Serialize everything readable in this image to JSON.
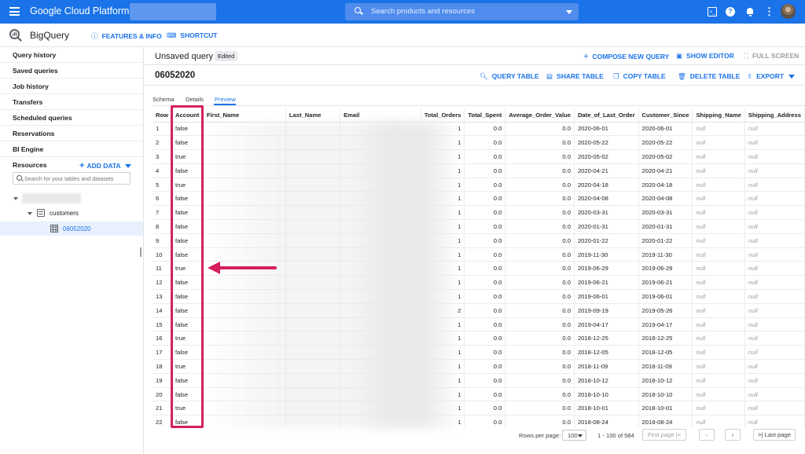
{
  "topbar": {
    "brand": "Google Cloud Platform",
    "search_placeholder": "Search products and resources"
  },
  "subheader": {
    "product": "BigQuery",
    "features_label": "FEATURES & INFO",
    "shortcut_label": "SHORTCUT"
  },
  "sidebar": {
    "items": [
      "Query history",
      "Saved queries",
      "Job history",
      "Transfers",
      "Scheduled queries",
      "Reservations",
      "BI Engine"
    ],
    "resources_label": "Resources",
    "add_data_label": "ADD DATA",
    "search_placeholder": "Search for your tables and datasets",
    "dataset": "customers",
    "table": "06052020"
  },
  "editor": {
    "title": "Unsaved query",
    "edited_badge": "Edited",
    "compose_label": "COMPOSE NEW QUERY",
    "show_editor_label": "SHOW EDITOR",
    "full_screen_label": "FULL SCREEN"
  },
  "table_view": {
    "name": "06052020",
    "actions": {
      "query": "QUERY TABLE",
      "share": "SHARE TABLE",
      "copy": "COPY TABLE",
      "delete": "DELETE TABLE",
      "export": "EXPORT"
    },
    "tabs": [
      "Schema",
      "Details",
      "Preview"
    ]
  },
  "grid": {
    "columns": [
      "Row",
      "Account",
      "First_Name",
      "Last_Name",
      "Email",
      "Total_Orders",
      "Total_Spent",
      "Average_Order_Value",
      "Date_of_Last_Order",
      "Customer_Since",
      "Shipping_Name",
      "Shipping_Address"
    ],
    "rows": [
      [
        "1",
        "false",
        "",
        "",
        "",
        "1",
        "0.0",
        "0.0",
        "2020-06-01",
        "2020-06-01",
        "null",
        "null"
      ],
      [
        "2",
        "false",
        "",
        "",
        "",
        "1",
        "0.0",
        "0.0",
        "2020-05-22",
        "2020-05-22",
        "null",
        "null"
      ],
      [
        "3",
        "true",
        "",
        "",
        "",
        "1",
        "0.0",
        "0.0",
        "2020-05-02",
        "2020-05-02",
        "null",
        "null"
      ],
      [
        "4",
        "false",
        "",
        "",
        "",
        "1",
        "0.0",
        "0.0",
        "2020-04-21",
        "2020-04-21",
        "null",
        "null"
      ],
      [
        "5",
        "true",
        "",
        "",
        "",
        "1",
        "0.0",
        "0.0",
        "2020-04-18",
        "2020-04-18",
        "null",
        "null"
      ],
      [
        "6",
        "false",
        "",
        "",
        "",
        "1",
        "0.0",
        "0.0",
        "2020-04-08",
        "2020-04-08",
        "null",
        "null"
      ],
      [
        "7",
        "false",
        "",
        "",
        "",
        "1",
        "0.0",
        "0.0",
        "2020-03-31",
        "2020-03-31",
        "null",
        "null"
      ],
      [
        "8",
        "false",
        "",
        "",
        "",
        "1",
        "0.0",
        "0.0",
        "2020-01-31",
        "2020-01-31",
        "null",
        "null"
      ],
      [
        "9",
        "false",
        "",
        "",
        "",
        "1",
        "0.0",
        "0.0",
        "2020-01-22",
        "2020-01-22",
        "null",
        "null"
      ],
      [
        "10",
        "false",
        "",
        "",
        "",
        "1",
        "0.0",
        "0.0",
        "2019-11-30",
        "2019-11-30",
        "null",
        "null"
      ],
      [
        "11",
        "true",
        "",
        "",
        "",
        "1",
        "0.0",
        "0.0",
        "2019-06-29",
        "2019-06-29",
        "null",
        "null"
      ],
      [
        "12",
        "false",
        "",
        "",
        "",
        "1",
        "0.0",
        "0.0",
        "2019-06-21",
        "2019-06-21",
        "null",
        "null"
      ],
      [
        "13",
        "false",
        "",
        "",
        "",
        "1",
        "0.0",
        "0.0",
        "2019-06-01",
        "2019-06-01",
        "null",
        "null"
      ],
      [
        "14",
        "false",
        "",
        "",
        "",
        "2",
        "0.0",
        "0.0",
        "2019-09-19",
        "2019-05-26",
        "null",
        "null"
      ],
      [
        "15",
        "false",
        "",
        "",
        "",
        "1",
        "0.0",
        "0.0",
        "2019-04-17",
        "2019-04-17",
        "null",
        "null"
      ],
      [
        "16",
        "true",
        "",
        "",
        "",
        "1",
        "0.0",
        "0.0",
        "2018-12-25",
        "2018-12-25",
        "null",
        "null"
      ],
      [
        "17",
        "false",
        "",
        "",
        "",
        "1",
        "0.0",
        "0.0",
        "2018-12-05",
        "2018-12-05",
        "null",
        "null"
      ],
      [
        "18",
        "true",
        "",
        "",
        "",
        "1",
        "0.0",
        "0.0",
        "2018-11-09",
        "2018-11-09",
        "null",
        "null"
      ],
      [
        "19",
        "false",
        "",
        "",
        "",
        "1",
        "0.0",
        "0.0",
        "2018-10-12",
        "2018-10-12",
        "null",
        "null"
      ],
      [
        "20",
        "false",
        "",
        "",
        "",
        "1",
        "0.0",
        "0.0",
        "2018-10-10",
        "2018-10-10",
        "null",
        "null"
      ],
      [
        "21",
        "true",
        "",
        "",
        "",
        "1",
        "0.0",
        "0.0",
        "2018-10-01",
        "2018-10-01",
        "null",
        "null"
      ],
      [
        "22",
        "false",
        "",
        "",
        "",
        "1",
        "0.0",
        "0.0",
        "2018-08-24",
        "2018-08-24",
        "null",
        "null"
      ]
    ]
  },
  "pager": {
    "rows_per_page_label": "Rows per page:",
    "rows_per_page": "100",
    "range": "1 - 100 of 584",
    "first_label": "First page",
    "last_label": "Last page"
  },
  "colors": {
    "brand_blue": "#1a73e8",
    "highlight": "#d51f5f"
  }
}
